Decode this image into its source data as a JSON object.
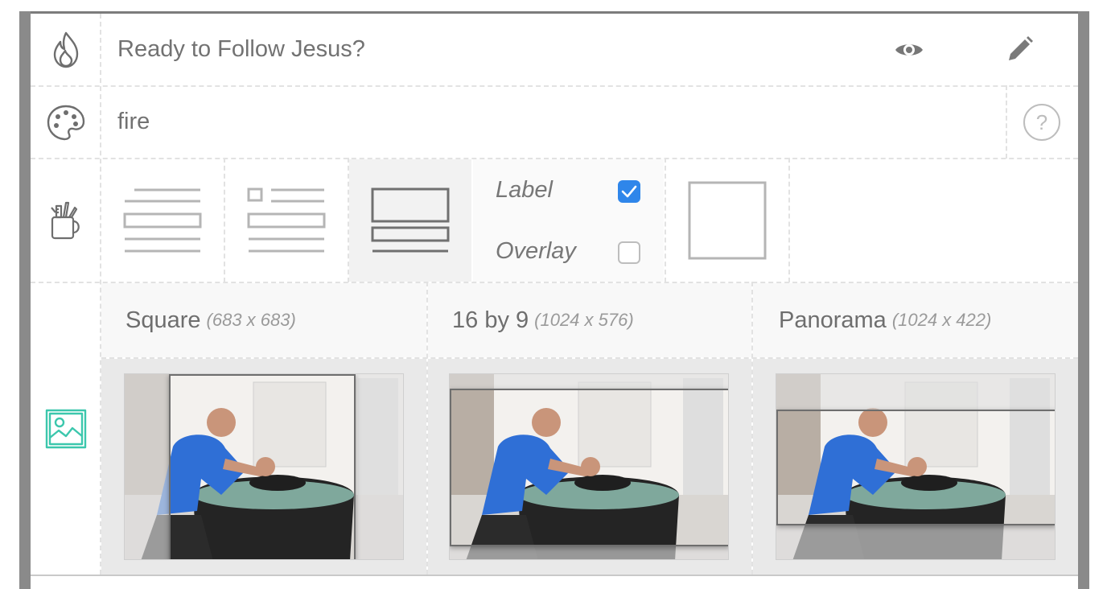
{
  "header": {
    "title": "Ready to Follow Jesus?",
    "title_icon": "flame-icon",
    "preview_icon": "eye-icon",
    "edit_icon": "pencil-icon"
  },
  "theme": {
    "value": "fire",
    "icon": "palette-icon",
    "help_icon": "question-circle-icon"
  },
  "layout": {
    "icon": "tools-cup-icon",
    "options": [
      {
        "name": "text-only-layout",
        "selected": false
      },
      {
        "name": "small-image-text-layout",
        "selected": false
      },
      {
        "name": "image-top-layout",
        "selected": true
      },
      {
        "name": "image-only-layout",
        "selected": false
      }
    ],
    "label_option": "Label",
    "label_checked": true,
    "overlay_option": "Overlay",
    "overlay_checked": false
  },
  "crops": {
    "icon": "image-icon",
    "items": [
      {
        "name": "Square",
        "dims": "(683 x 683)"
      },
      {
        "name": "16 by 9",
        "dims": "(1024 x 576)"
      },
      {
        "name": "Panorama",
        "dims": "(1024 x 422)"
      }
    ]
  },
  "colors": {
    "accent_teal": "#3cc7ad",
    "checkbox_blue": "#2f86ea"
  }
}
